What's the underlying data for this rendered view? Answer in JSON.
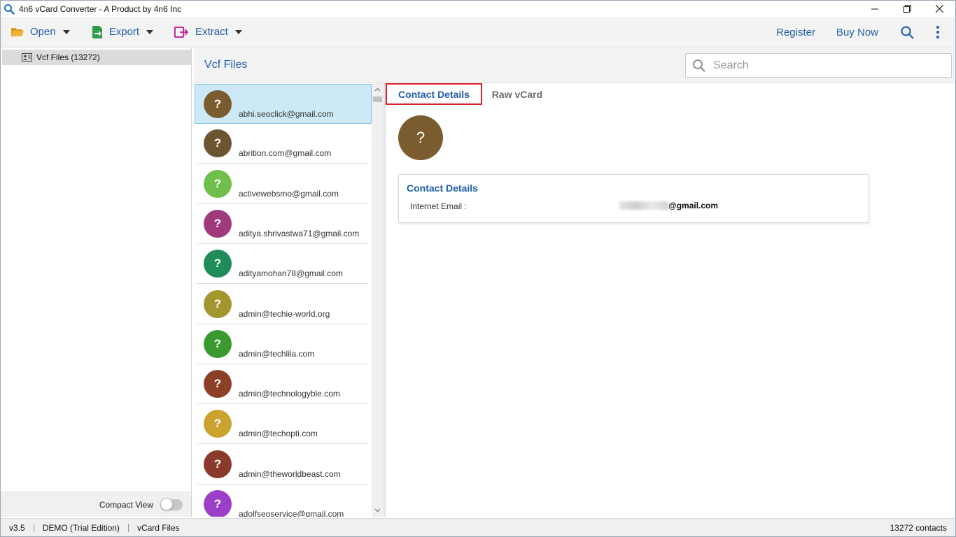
{
  "window": {
    "title": "4n6 vCard Converter - A Product by 4n6 Inc"
  },
  "toolbar": {
    "open_label": "Open",
    "export_label": "Export",
    "extract_label": "Extract",
    "register_label": "Register",
    "buy_now_label": "Buy Now",
    "icons": [
      "folder-open-icon",
      "export-icon",
      "extract-icon",
      "search-icon",
      "more-vertical-icon"
    ]
  },
  "sidebar": {
    "tree_item_label": "Vcf Files (13272)",
    "compact_view_label": "Compact View",
    "compact_view_on": false
  },
  "main": {
    "title": "Vcf Files",
    "search_placeholder": "Search"
  },
  "contacts": [
    {
      "email": "abhi.seoclick@gmail.com",
      "color": "#7a5c2e",
      "selected": true
    },
    {
      "email": "abrition.com@gmail.com",
      "color": "#6b5430"
    },
    {
      "email": "activewebsmo@gmail.com",
      "color": "#6fbf4a"
    },
    {
      "email": "aditya.shrivastwa71@gmail.com",
      "color": "#a03a7c"
    },
    {
      "email": "adityamohan78@gmail.com",
      "color": "#1f8c5a"
    },
    {
      "email": "admin@techie-world.org",
      "color": "#a3962f"
    },
    {
      "email": "admin@techlila.com",
      "color": "#3a9a2f"
    },
    {
      "email": "admin@technologyble.com",
      "color": "#8c4028"
    },
    {
      "email": "admin@techopti.com",
      "color": "#c9a22f"
    },
    {
      "email": "admin@theworldbeast.com",
      "color": "#8a3a2a"
    },
    {
      "email": "adolfseoservice@gmail.com",
      "color": "#9b3fc9"
    }
  ],
  "avatar_glyph": "?",
  "details": {
    "tab_contact_details": "Contact Details",
    "tab_raw_vcard": "Raw vCard",
    "card_title": "Contact Details",
    "field_label": "Internet Email :",
    "field_value_visible": "@gmail.com",
    "avatar_color": "#7a5c2e"
  },
  "status": {
    "version": "v3.5",
    "edition": "DEMO (Trial Edition)",
    "file_type": "vCard Files",
    "contact_count": "13272 contacts"
  },
  "colors": {
    "accent": "#1f5fa8",
    "selected_row": "#cde8f6",
    "active_tab_border": "#e0202a"
  }
}
